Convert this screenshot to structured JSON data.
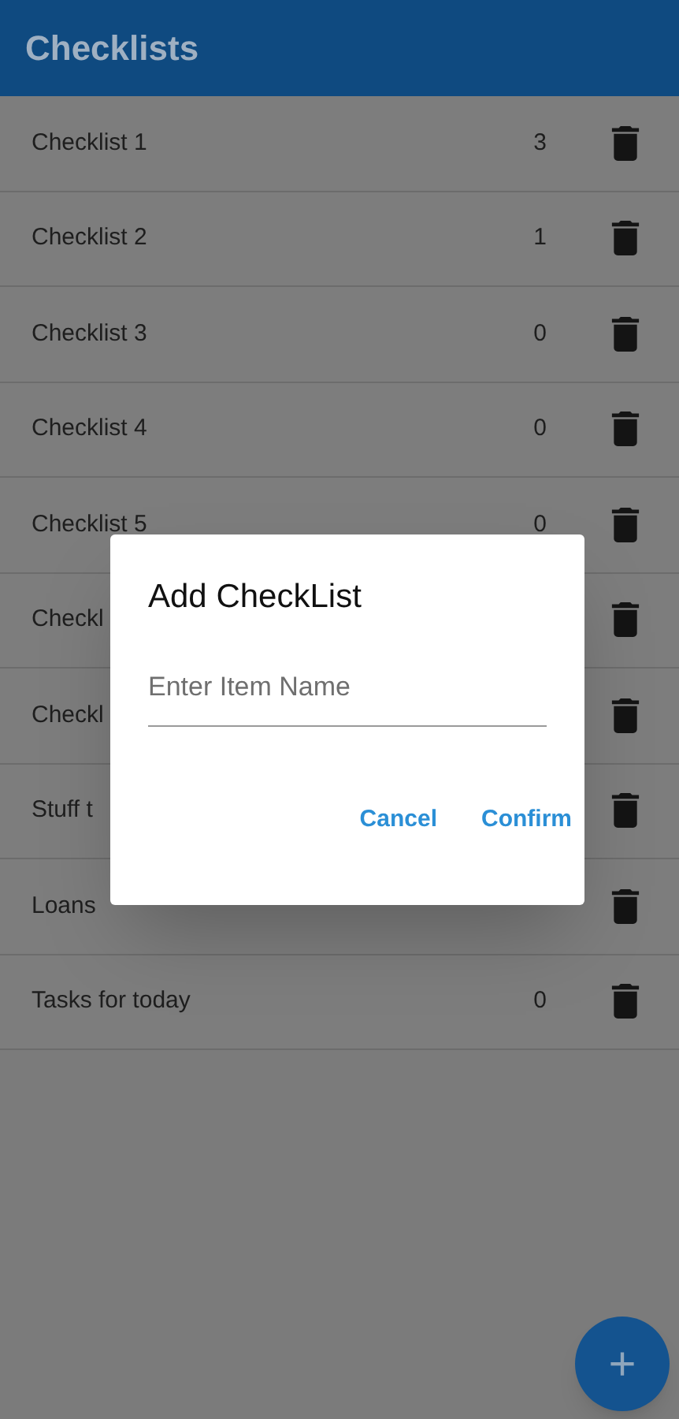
{
  "app_bar": {
    "title": "Checklists"
  },
  "checklists": [
    {
      "name": "Checklist 1",
      "count": "3"
    },
    {
      "name": "Checklist 2",
      "count": "1"
    },
    {
      "name": "Checklist 3",
      "count": "0"
    },
    {
      "name": "Checklist 4",
      "count": "0"
    },
    {
      "name": "Checklist 5",
      "count": "0"
    },
    {
      "name": "Checkl"
    },
    {
      "name": "Checkl"
    },
    {
      "name": "Stuff t"
    },
    {
      "name": "Loans"
    },
    {
      "name": "Tasks for today",
      "count": "0"
    }
  ],
  "dialog": {
    "title": "Add CheckList",
    "field": {
      "placeholder": "Enter Item Name"
    },
    "buttons": [
      "Cancel",
      "Confirm"
    ]
  },
  "fab": {
    "label": "+"
  }
}
